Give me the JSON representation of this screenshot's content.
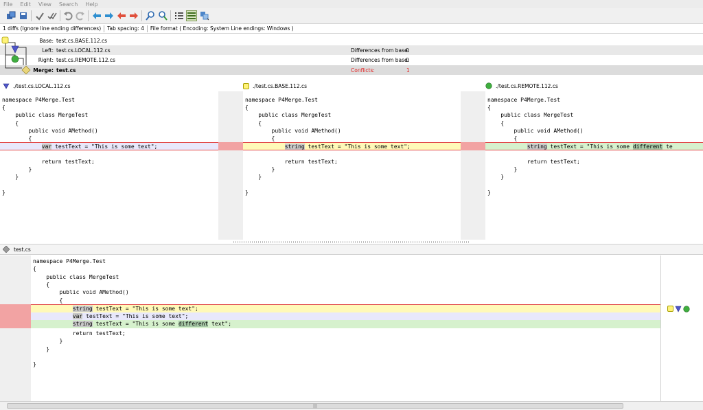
{
  "menu": [
    "File",
    "Edit",
    "View",
    "Search",
    "Help"
  ],
  "toolbar": {
    "icons": [
      "save-all-icon",
      "save-icon",
      "check-icon",
      "check-all-icon",
      "undo-icon",
      "redo-icon",
      "prev-diff-icon",
      "next-diff-icon",
      "prev-conflict-icon",
      "next-conflict-icon",
      "find-icon",
      "find-next-icon",
      "line-numbers-icon",
      "side-by-side-icon",
      "merge-arrange-icon"
    ]
  },
  "status": {
    "diffs": "1 diffs (Ignore line ending differences)",
    "tab_spacing": "Tab spacing: 4",
    "file_format": "File format ( Encoding: System  Line endings: Windows )"
  },
  "files": {
    "base": {
      "label": "Base:",
      "file": "test.cs.BASE.112.cs"
    },
    "left": {
      "label": "Left:",
      "file": "test.cs.LOCAL.112.cs",
      "diff_label": "Differences from base:",
      "diff_value": "0"
    },
    "right": {
      "label": "Right:",
      "file": "test.cs.REMOTE.112.cs",
      "diff_label": "Differences from base:",
      "diff_value": "0"
    },
    "merge": {
      "label": "Merge:",
      "file": "test.cs",
      "conflicts_label": "Conflicts:",
      "conflicts_value": "1"
    }
  },
  "panes": {
    "local": {
      "path": "./test.cs.LOCAL.112.cs",
      "lines": [
        "namespace P4Merge.Test",
        "{",
        "    public class MergeTest",
        "    {",
        "        public void AMethod()",
        "        {",
        "",
        "            return testText;",
        "        }",
        "    }",
        "",
        "}"
      ],
      "conflict_kw": "var",
      "conflict_rest": " testText = \"This is some text\";"
    },
    "base": {
      "path": "./test.cs.BASE.112.cs",
      "lines": [
        "namespace P4Merge.Test",
        "{",
        "    public class MergeTest",
        "    {",
        "        public void AMethod()",
        "        {",
        "",
        "            return testText;",
        "        }",
        "    }",
        "",
        "}"
      ],
      "conflict_kw": "string",
      "conflict_rest": " testText = \"This is some text\";"
    },
    "remote": {
      "path": "./test.cs.REMOTE.112.cs",
      "lines": [
        "namespace P4Merge.Test",
        "{",
        "    public class MergeTest",
        "    {",
        "        public void AMethod()",
        "        {",
        "",
        "            return testText;",
        "        }",
        "    }",
        "",
        "}"
      ],
      "conflict_kw": "string",
      "conflict_mid": " testText = \"This is some ",
      "conflict_diff": "different",
      "conflict_end": " te"
    }
  },
  "merge": {
    "file": "test.cs",
    "top_lines": [
      "namespace P4Merge.Test",
      "{",
      "    public class MergeTest",
      "    {",
      "        public void AMethod()",
      "        {"
    ],
    "c1_kw": "string",
    "c1_rest": " testText = \"This is some text\";",
    "c2_kw": "var",
    "c2_rest": " testText = \"This is some text\";",
    "c3_kw": "string",
    "c3_mid": " testText = \"This is some ",
    "c3_diff": "different",
    "c3_end": " text\";",
    "bottom_lines": [
      "            return testText;",
      "        }",
      "    }",
      "",
      "}"
    ]
  },
  "colors": {
    "base_yellow": "#fff7b3",
    "local_blue": "#e6e6fb",
    "remote_green": "#d7f2cf",
    "conflict_red": "#e24b4b",
    "gutter_red": "#f0a0a0"
  }
}
